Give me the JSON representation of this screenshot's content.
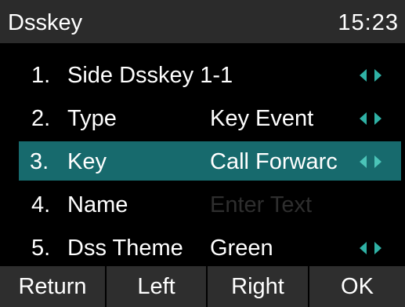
{
  "header": {
    "title": "Dsskey",
    "time": "15:23"
  },
  "rows": [
    {
      "number": "1.",
      "label": "Side Dsskey 1-1",
      "value": "",
      "has_arrows": true,
      "selected": false
    },
    {
      "number": "2.",
      "label": "Type",
      "value": "Key Event",
      "has_arrows": true,
      "selected": false
    },
    {
      "number": "3.",
      "label": "Key",
      "value": "Call Forwarc",
      "has_arrows": true,
      "selected": true
    },
    {
      "number": "4.",
      "label": "Name",
      "value": "",
      "placeholder": "Enter Text",
      "has_arrows": false,
      "selected": false
    },
    {
      "number": "5.",
      "label": "Dss Theme",
      "value": "Green",
      "has_arrows": true,
      "selected": false
    }
  ],
  "softkeys": {
    "return": "Return",
    "left": "Left",
    "right": "Right",
    "ok": "OK"
  },
  "colors": {
    "background": "#000000",
    "title_bar": "#2b2b2b",
    "highlight": "#176a6d",
    "arrow": "#2fb1a5",
    "softkey_bar": "#2e2e2e",
    "placeholder_text": "#2e2e2e"
  },
  "icons": {
    "arrows": [
      "left-arrow-icon",
      "right-arrow-icon"
    ]
  }
}
